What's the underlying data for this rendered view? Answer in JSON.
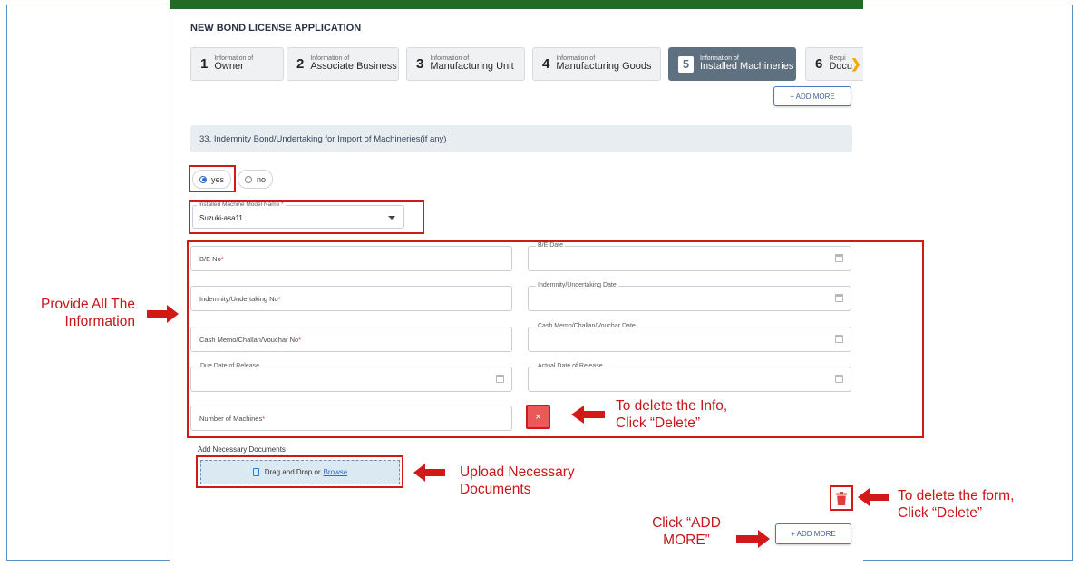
{
  "header": {
    "title": "NEW BOND LICENSE APPLICATION"
  },
  "steps": [
    {
      "num": "1",
      "small": "Information of",
      "label": "Owner",
      "active": false
    },
    {
      "num": "2",
      "small": "Information of",
      "label": "Associate Business",
      "active": false
    },
    {
      "num": "3",
      "small": "Information of",
      "label": "Manufacturing Unit",
      "active": false
    },
    {
      "num": "4",
      "small": "Information of",
      "label": "Manufacturing Goods",
      "active": false
    },
    {
      "num": "5",
      "small": "Information of",
      "label": "Installed Machineries",
      "active": true
    },
    {
      "num": "6",
      "small": "Requi",
      "label": "Docu",
      "active": false
    }
  ],
  "add_more_top": "+ ADD MORE",
  "section": {
    "title": "33. Indemnity Bond/Undertaking for Import of Machineries(if any)"
  },
  "radio": {
    "yes": "yes",
    "no": "no",
    "selected": "yes"
  },
  "machine_select": {
    "label": "Installed Machine Model Name",
    "value": "Suzuki-asa11"
  },
  "form": {
    "be_no": "B/E No",
    "be_date": "B/E Date",
    "indemnity_no": "Indemnity/Undertaking No",
    "indemnity_date": "Indemnity/Undertaking Date",
    "cash_memo_no": "Cash Memo/Challan/Vouchar No",
    "cash_memo_date": "Cash Memo/Challan/Vouchar Date",
    "due_date": "Due Date of Release",
    "actual_date": "Actual Date of Release",
    "num_machines": "Number of Machines",
    "required_mark": "*"
  },
  "delete_x": "×",
  "docs": {
    "label": "Add Necessary Documents",
    "drop_text": "Drag and Drop or",
    "browse": "Browse"
  },
  "add_more_bottom": "+ ADD MORE",
  "annotations": {
    "provide_info": [
      "Provide All The",
      "Information"
    ],
    "delete_info": [
      "To delete the Info,",
      "Click “Delete”"
    ],
    "upload_docs": [
      "Upload Necessary",
      "Documents"
    ],
    "delete_form": [
      "To delete the form,",
      "Click “Delete”"
    ],
    "add_more": [
      "Click “ADD",
      "MORE”"
    ]
  },
  "colors": {
    "accent_red": "#d11919",
    "header_green": "#236a27",
    "active_step": "#5f7180"
  },
  "icons": {
    "calendar": "calendar-icon",
    "trash": "trash-icon",
    "file": "file-icon",
    "caret": "chevron-down-icon",
    "next": "chevron-right-icon"
  }
}
